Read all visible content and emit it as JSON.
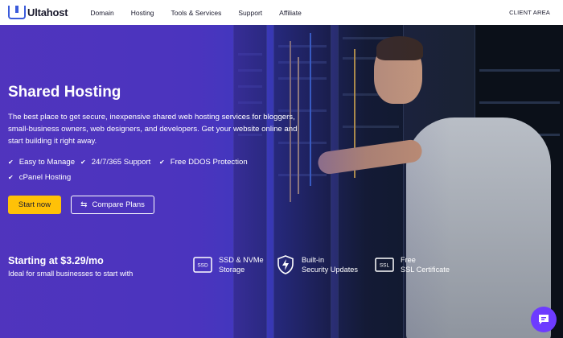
{
  "nav": {
    "logo": "Ultahost",
    "menu": [
      "Domain",
      "Hosting",
      "Tools & Services",
      "Support",
      "Affiliate"
    ],
    "client_area": "CLIENT AREA"
  },
  "hero": {
    "title": "Shared Hosting",
    "description": "The best place to get secure, inexpensive shared web hosting services for bloggers, small-business owners, web designers, and developers. Get your website online and start building it right away.",
    "features": [
      "Easy to Manage",
      "24/7/365 Support",
      "Free DDOS Protection",
      "cPanel Hosting"
    ],
    "start_button": "Start now",
    "compare_button": "Compare Plans",
    "price": "Starting at $3.29/mo",
    "price_sub": "Ideal for small businesses to start with",
    "badges": [
      {
        "line1": "SSD & NVMe",
        "line2": "Storage",
        "icon_text": "SSD",
        "icon": "ssd-icon"
      },
      {
        "line1": "Built-in",
        "line2": "Security Updates",
        "icon": "shield-bolt-icon"
      },
      {
        "line1": "Free",
        "line2": "SSL Certificate",
        "icon_text": "SSL",
        "icon": "ssl-icon"
      }
    ]
  },
  "colors": {
    "accent": "#ffc107",
    "brand": "#3b5bdb",
    "hero": "#4a34bd",
    "chat": "#6d3bff"
  }
}
